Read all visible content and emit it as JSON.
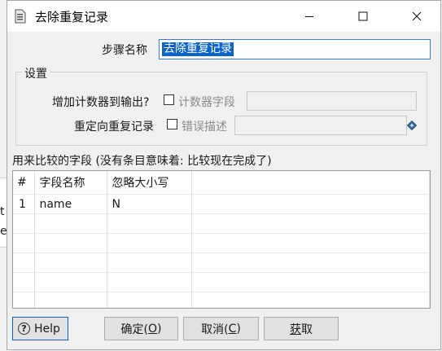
{
  "background": {
    "chars": [
      "t",
      "e"
    ]
  },
  "window": {
    "title": "去除重复记录",
    "minimize_glyph": "—",
    "maximize_glyph": "☐",
    "close_glyph": "✕"
  },
  "step": {
    "label": "步骤名称",
    "value": "去除重复记录"
  },
  "settings": {
    "legend": "设置",
    "add_counter_label": "增加计数器到输出?",
    "counter_field_label": "计数器字段",
    "counter_field_value": "",
    "redirect_label": "重定向重复记录",
    "error_desc_label": "错误描述",
    "error_desc_value": ""
  },
  "fields": {
    "caption": "用来比较的字段 (没有条目意味着: 比较现在完成了)",
    "columns": [
      "#",
      "字段名称",
      "忽略大小写"
    ],
    "rows": [
      {
        "num": "1",
        "name": "name",
        "ignore_case": "N"
      }
    ]
  },
  "buttons": {
    "help": "Help",
    "ok_prefix": "确定(",
    "ok_key": "O",
    "ok_suffix": ")",
    "cancel_prefix": "取消(",
    "cancel_key": "C",
    "cancel_suffix": ")",
    "get_key": "获",
    "get_rest": "取"
  },
  "colors": {
    "selection": "#0a64c8",
    "focus_border": "#3c7fc8"
  }
}
